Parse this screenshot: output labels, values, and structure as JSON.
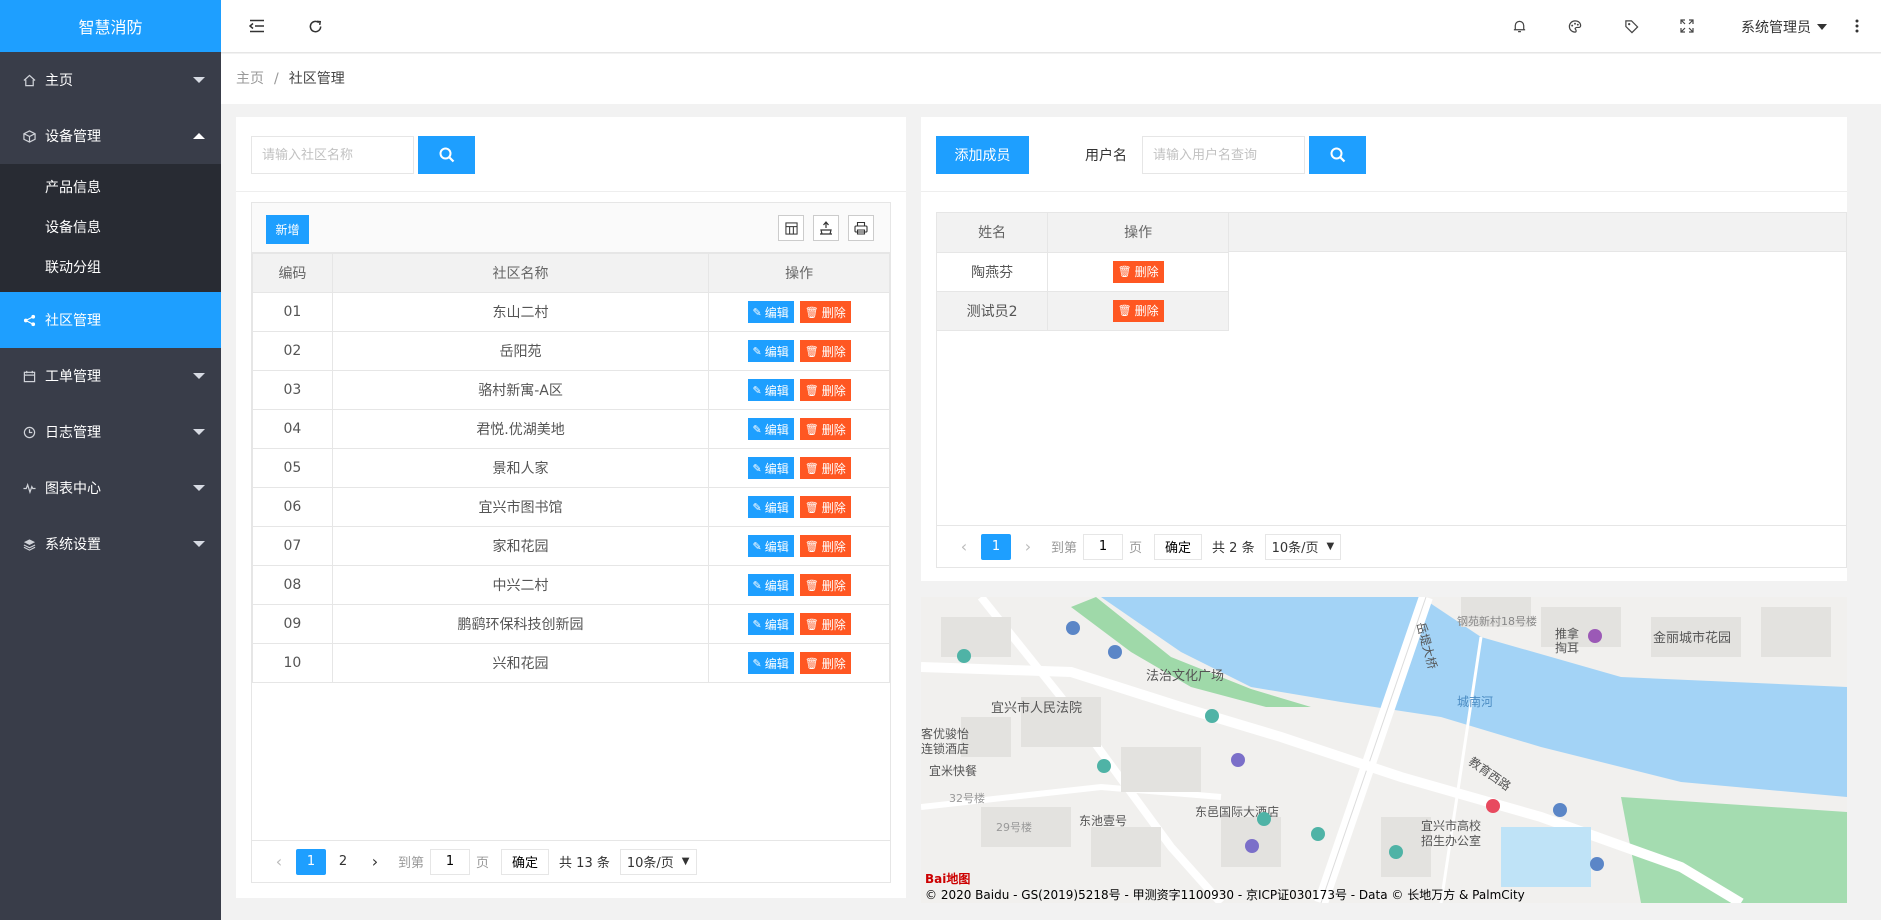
{
  "sidebar": {
    "logo": "智慧消防",
    "items": [
      {
        "label": "主页",
        "icon": "home-icon"
      },
      {
        "label": "设备管理",
        "icon": "cube-icon"
      },
      {
        "label": "社区管理",
        "icon": "share-icon"
      },
      {
        "label": "工单管理",
        "icon": "calendar-icon"
      },
      {
        "label": "日志管理",
        "icon": "clock-icon"
      },
      {
        "label": "图表中心",
        "icon": "pulse-icon"
      },
      {
        "label": "系统设置",
        "icon": "layers-icon"
      }
    ],
    "sub_items": [
      "产品信息",
      "设备信息",
      "联动分组"
    ]
  },
  "header": {
    "user": "系统管理员",
    "icons": [
      "menu-fold-icon",
      "refresh-icon",
      "bell-icon",
      "theme-icon",
      "tag-icon",
      "fullscreen-icon",
      "more-icon"
    ]
  },
  "breadcrumb": {
    "home": "主页",
    "sep": "/",
    "current": "社区管理"
  },
  "left": {
    "search_placeholder": "请输入社区名称",
    "add_label": "新增",
    "columns": [
      "编码",
      "社区名称",
      "操作"
    ],
    "edit_label": "编辑",
    "delete_label": "删除",
    "rows": [
      {
        "code": "01",
        "name": "东山二村"
      },
      {
        "code": "02",
        "name": "岳阳苑"
      },
      {
        "code": "03",
        "name": "骆村新寓-A区"
      },
      {
        "code": "04",
        "name": "君悦.优湖美地"
      },
      {
        "code": "05",
        "name": "景和人家"
      },
      {
        "code": "06",
        "name": "宜兴市图书馆"
      },
      {
        "code": "07",
        "name": "家和花园"
      },
      {
        "code": "08",
        "name": "中兴二村"
      },
      {
        "code": "09",
        "name": "鹏鹞环保科技创新园"
      },
      {
        "code": "10",
        "name": "兴和花园"
      }
    ],
    "pager": {
      "current": "1",
      "next_page": "2",
      "goto": "到第",
      "page_value": "1",
      "page_unit": "页",
      "ok": "确定",
      "total": "共 13 条",
      "size": "10条/页"
    }
  },
  "right": {
    "add_member": "添加成员",
    "user_label": "用户名",
    "user_placeholder": "请输入用户名查询",
    "columns": [
      "姓名",
      "操作"
    ],
    "delete_label": "删除",
    "rows": [
      {
        "name": "陶燕芬"
      },
      {
        "name": "测试员2"
      }
    ],
    "pager": {
      "current": "1",
      "goto": "到第",
      "page_value": "1",
      "page_unit": "页",
      "ok": "确定",
      "total": "共 2 条",
      "size": "10条/页"
    }
  },
  "map": {
    "labels": [
      "法治文化广场",
      "宜兴市人民法院",
      "东邑国际大酒店",
      "东池壹号",
      "宜米快餐",
      "客优骏怡",
      "连锁酒店",
      "金丽城市花园",
      "城南河",
      "教育西路",
      "岳堤大桥",
      "宜兴市高校",
      "招生办公室",
      "推拿",
      "掏耳",
      "钢苑新村18号楼",
      "32号楼",
      "29号楼"
    ],
    "copyright": "© 2020 Baidu - GS(2019)5218号 - 甲测资字1100930 - 京ICP证030173号 - Data © 长地万方 & PalmCity",
    "logo": "Bai地图"
  }
}
